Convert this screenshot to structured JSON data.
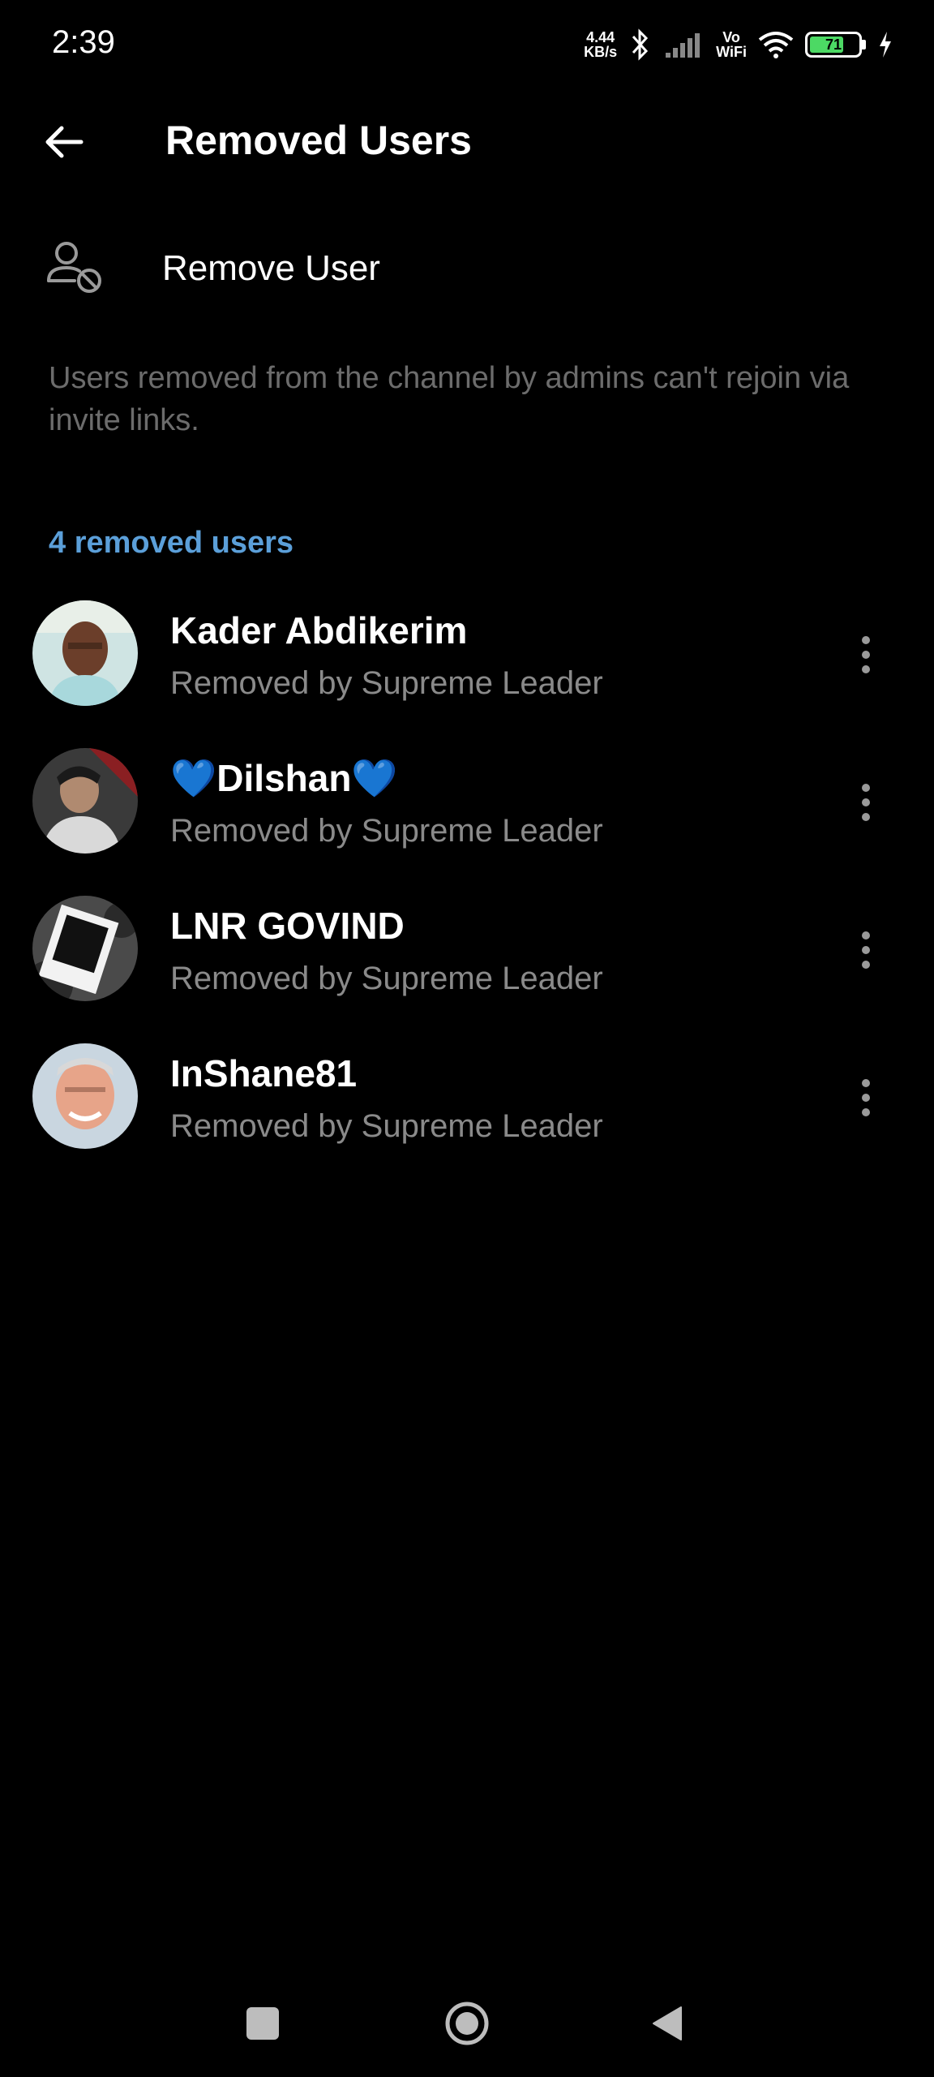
{
  "status_bar": {
    "time": "2:39",
    "net_speed_value": "4.44",
    "net_speed_unit": "KB/s",
    "vo_label": "Vo",
    "wifi_label": "WiFi",
    "battery_level": "71",
    "battery_fraction": 0.71,
    "battery_color": "#4cd964"
  },
  "header": {
    "back_icon": "arrow-left-icon",
    "title": "Removed Users"
  },
  "remove_user": {
    "icon": "user-remove-icon",
    "label": "Remove User"
  },
  "info_text": "Users removed from the channel by admins can't rejoin via invite links.",
  "section": {
    "title": "4 removed users",
    "accent_color": "#5b9fd9"
  },
  "users": [
    {
      "name": "Kader Abdikerim",
      "subtitle": "Removed by Supreme Leader"
    },
    {
      "name": "💙Dilshan💙",
      "subtitle": "Removed by Supreme Leader"
    },
    {
      "name": "LNR GOVIND",
      "subtitle": "Removed by Supreme Leader"
    },
    {
      "name": "InShane81",
      "subtitle": "Removed by Supreme Leader"
    }
  ],
  "nav_bar": {
    "recent_icon": "square-icon",
    "home_icon": "circle-icon",
    "back_icon": "triangle-back-icon"
  }
}
